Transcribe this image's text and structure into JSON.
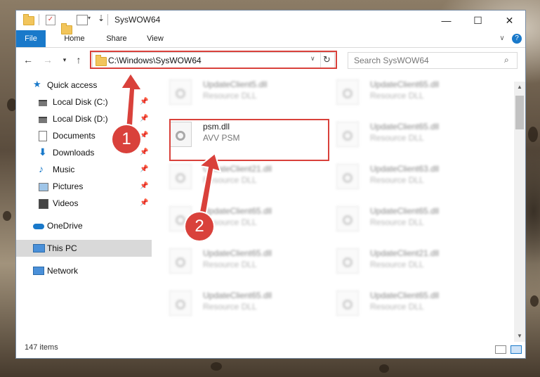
{
  "window": {
    "title": "SysWOW64",
    "status_items": "147 items"
  },
  "ribbon": {
    "tabs": [
      "File",
      "Home",
      "Share",
      "View"
    ]
  },
  "address": {
    "path": "C:\\Windows\\SysWOW64",
    "search_placeholder": "Search SysWOW64"
  },
  "nav": {
    "items": [
      {
        "label": "Quick access",
        "icon": "star-icon"
      },
      {
        "label": "Local Disk (C:)",
        "icon": "drive-icon"
      },
      {
        "label": "Local Disk (D:)",
        "icon": "drive-icon"
      },
      {
        "label": "Documents",
        "icon": "document-icon"
      },
      {
        "label": "Downloads",
        "icon": "download-icon"
      },
      {
        "label": "Music",
        "icon": "music-icon"
      },
      {
        "label": "Pictures",
        "icon": "pictures-icon"
      },
      {
        "label": "Videos",
        "icon": "videos-icon"
      },
      {
        "label": "OneDrive",
        "icon": "cloud-icon"
      },
      {
        "label": "This PC",
        "icon": "computer-icon"
      },
      {
        "label": "Network",
        "icon": "network-icon"
      }
    ]
  },
  "files": [
    {
      "name": "UpdateClient5.dll",
      "desc": "Resource DLL"
    },
    {
      "name": "UpdateClient65.dll",
      "desc": "Resource DLL"
    },
    {
      "name": "psm.dll",
      "desc": "AVV PSM"
    },
    {
      "name": "UpdateClient65.dll",
      "desc": "Resource DLL"
    },
    {
      "name": "UpdateClient21.dll",
      "desc": "Resource DLL"
    },
    {
      "name": "UpdateClient63.dll",
      "desc": "Resource DLL"
    },
    {
      "name": "UpdateClient65.dll",
      "desc": "Resource DLL"
    },
    {
      "name": "UpdateClient65.dll",
      "desc": "Resource DLL"
    },
    {
      "name": "UpdateClient65.dll",
      "desc": "Resource DLL"
    },
    {
      "name": "UpdateClient21.dll",
      "desc": "Resource DLL"
    },
    {
      "name": "UpdateClient65.dll",
      "desc": "Resource DLL"
    },
    {
      "name": "UpdateClient65.dll",
      "desc": "Resource DLL"
    }
  ],
  "annotations": {
    "step1": "1",
    "step2": "2"
  },
  "colors": {
    "accent": "#1979ca",
    "highlight": "#d9413b"
  }
}
